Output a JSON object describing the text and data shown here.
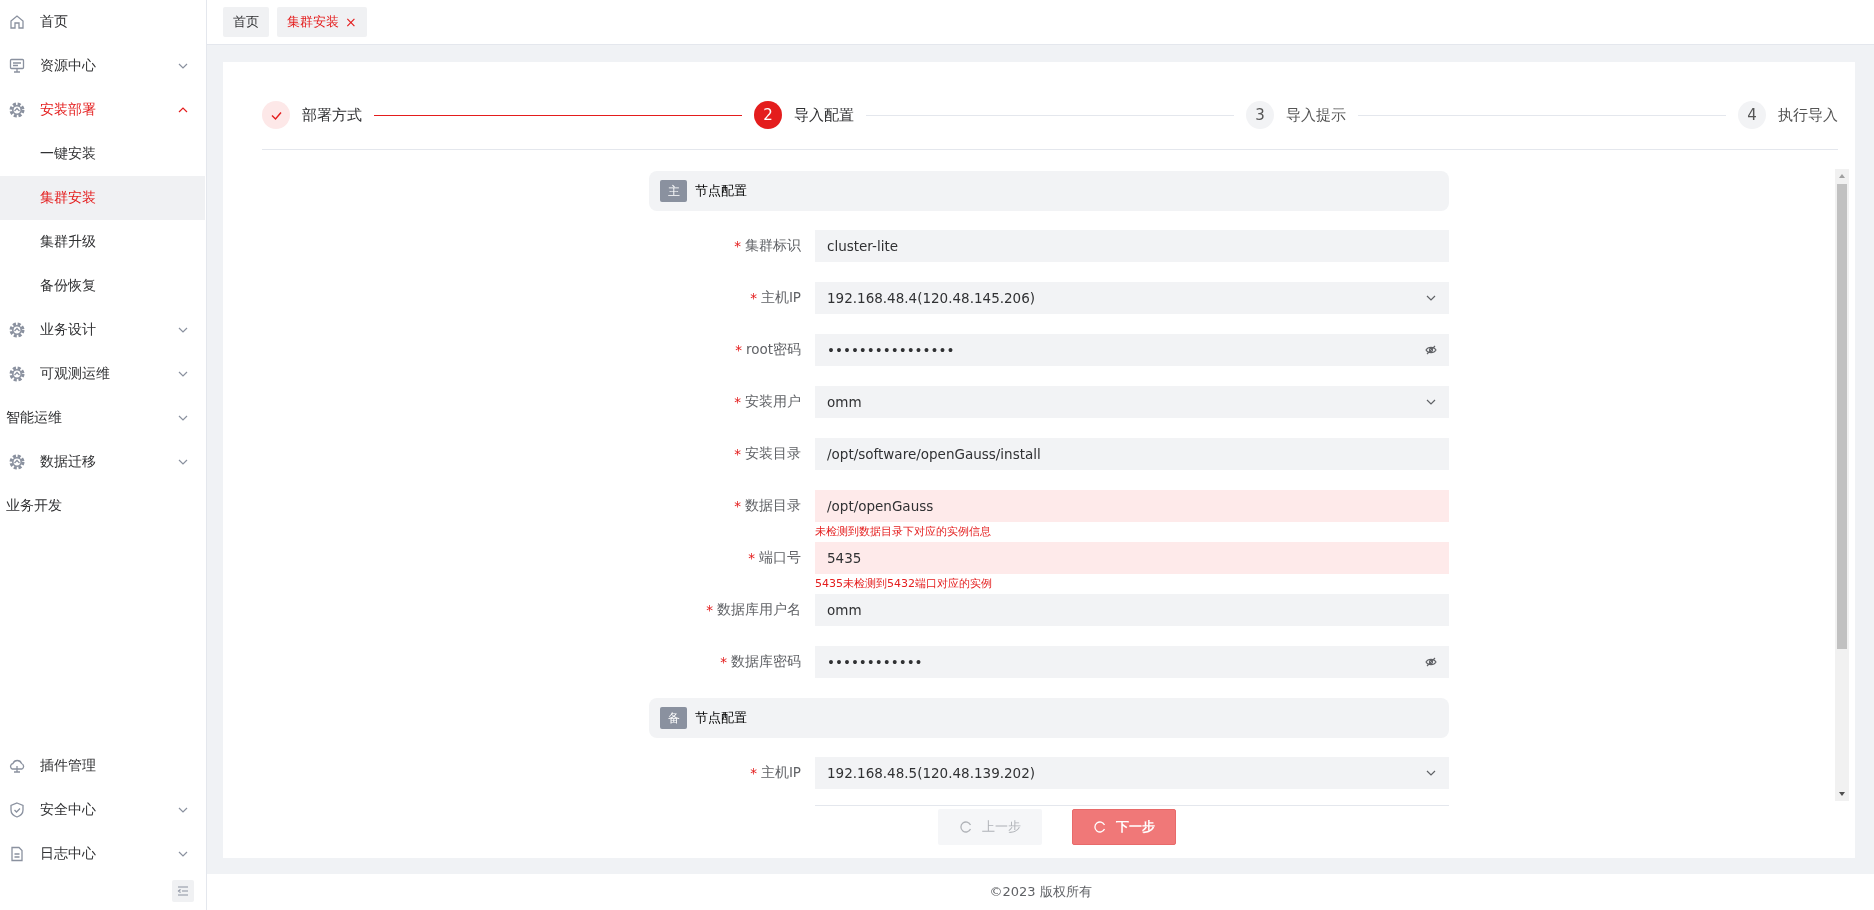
{
  "sidebar": {
    "menu": [
      {
        "label": "首页",
        "selected": false
      },
      {
        "label": "资源中心",
        "selected": false,
        "expanded": false
      },
      {
        "label": "安装部署",
        "selected": true,
        "expanded": true,
        "children": [
          {
            "label": "一键安装",
            "selected": false
          },
          {
            "label": "集群安装",
            "selected": true
          },
          {
            "label": "集群升级",
            "selected": false
          },
          {
            "label": "备份恢复",
            "selected": false
          }
        ]
      },
      {
        "label": "业务设计",
        "selected": false,
        "expanded": false
      },
      {
        "label": "可观测运维",
        "selected": false,
        "expanded": false
      },
      {
        "label": "智能运维",
        "selected": false,
        "expanded": false
      },
      {
        "label": "数据迁移",
        "selected": false,
        "expanded": false
      },
      {
        "label": "业务开发",
        "selected": false
      }
    ],
    "bottom_menu": [
      {
        "label": "插件管理",
        "selected": false
      },
      {
        "label": "安全中心",
        "selected": false,
        "expanded": false
      },
      {
        "label": "日志中心",
        "selected": false,
        "expanded": false
      }
    ]
  },
  "tabs": [
    {
      "label": "首页",
      "selected": false
    },
    {
      "label": "集群安装",
      "selected": true,
      "close": "×"
    }
  ],
  "steps": [
    {
      "label": "部署方式",
      "kind": "done"
    },
    {
      "number": "2",
      "label": "导入配置",
      "kind": "active"
    },
    {
      "number": "3",
      "label": "导入提示",
      "kind": "pending"
    },
    {
      "number": "4",
      "label": "执行导入",
      "kind": "pending"
    }
  ],
  "sections": [
    {
      "badge": "主",
      "title": "节点配置",
      "fields": [
        {
          "label": "集群标识",
          "required_mark": "*",
          "kind": "text",
          "value": "cluster-lite"
        },
        {
          "label": "主机IP",
          "required_mark": "*",
          "kind": "select",
          "value": "192.168.48.4(120.48.145.206)"
        },
        {
          "label": "root密码",
          "required_mark": "*",
          "kind": "password",
          "value": "••••••••••••••••"
        },
        {
          "label": "安装用户",
          "required_mark": "*",
          "kind": "select",
          "value": "omm"
        },
        {
          "label": "安装目录",
          "required_mark": "*",
          "kind": "text",
          "value": "/opt/software/openGauss/install"
        },
        {
          "label": "数据目录",
          "required_mark": "*",
          "kind": "text",
          "value": "/opt/openGauss",
          "error": "未检测到数据目录下对应的实例信息"
        },
        {
          "label": "端口号",
          "required_mark": "*",
          "kind": "text",
          "value": "5435",
          "error": "5435未检测到5432端口对应的实例"
        },
        {
          "label": "数据库用户名",
          "required_mark": "*",
          "kind": "text",
          "value": "omm"
        },
        {
          "label": "数据库密码",
          "required_mark": "*",
          "kind": "password",
          "value": "••••••••••••"
        }
      ]
    },
    {
      "badge": "备",
      "title": "节点配置",
      "fields": [
        {
          "label": "主机IP",
          "required_mark": "*",
          "kind": "select",
          "value": "192.168.48.5(120.48.139.202)"
        }
      ]
    }
  ],
  "buttons": [
    {
      "label": "上一步",
      "kind": "secondary",
      "loading": true
    },
    {
      "label": "下一步",
      "kind": "primary",
      "loading": true
    }
  ],
  "footer": "©2023 版权所有"
}
